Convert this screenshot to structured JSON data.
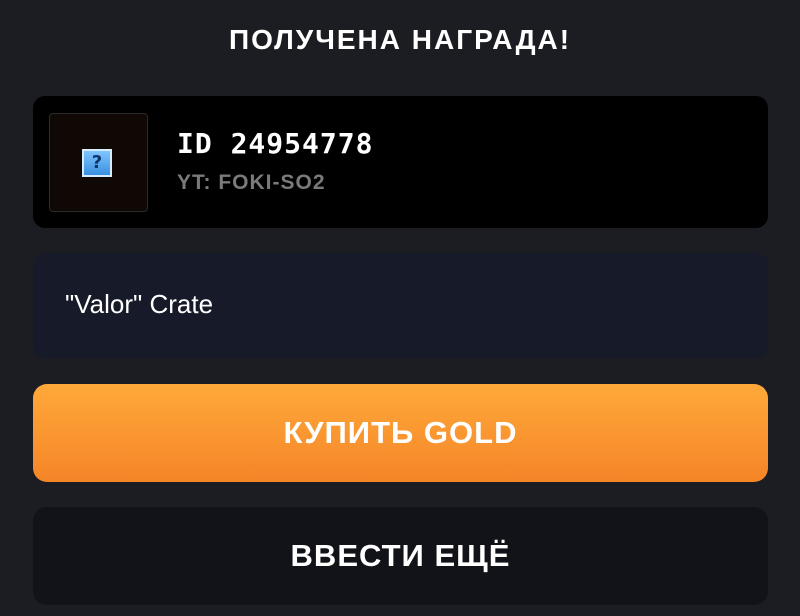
{
  "dialog": {
    "title": "ПОЛУЧЕНА НАГРАДА!"
  },
  "player": {
    "id_text": "ID 24954778",
    "tag": "YT: FOKI-SO2",
    "avatar_icon": "question-mark-icon",
    "avatar_icon_glyph": "?"
  },
  "reward": {
    "name": "\"Valor\" Crate"
  },
  "buttons": {
    "buy_gold": "КУПИТЬ GOLD",
    "enter_more": "ВВЕСТИ ЕЩЁ"
  },
  "colors": {
    "background": "#1c1d22",
    "card": "#000000",
    "reward_box": "#171a28",
    "accent_orange": "#f8952f",
    "secondary_button": "#121319"
  }
}
